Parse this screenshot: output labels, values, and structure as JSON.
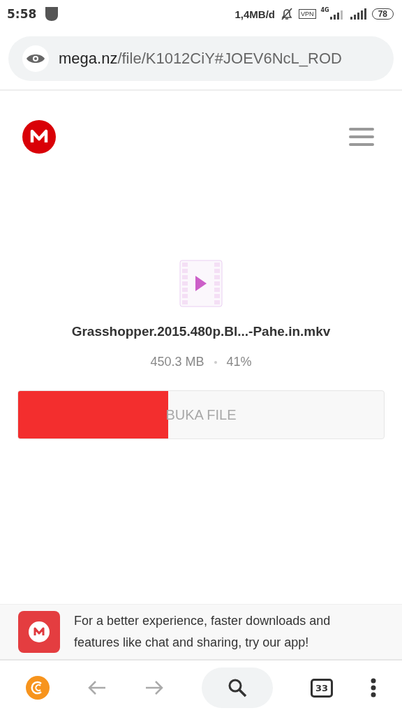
{
  "status_bar": {
    "time": "5:58",
    "speed": "1,4MB/d",
    "vpn": "VPN",
    "network": "4G",
    "battery": "78"
  },
  "address_bar": {
    "host": "mega.nz",
    "path": "/file/K1012CiY#JOEV6NcL_ROD"
  },
  "file": {
    "name": "Grasshopper.2015.480p.Bl...-Pahe.in.mkv",
    "size": "450.3 MB",
    "percent": "41%"
  },
  "download": {
    "level": 0.41,
    "label": "BUKA FILE"
  },
  "banner": {
    "text": "For a better experience, faster downloads and features like chat and sharing, try our app!"
  },
  "browser_nav": {
    "tab_count": "33"
  }
}
